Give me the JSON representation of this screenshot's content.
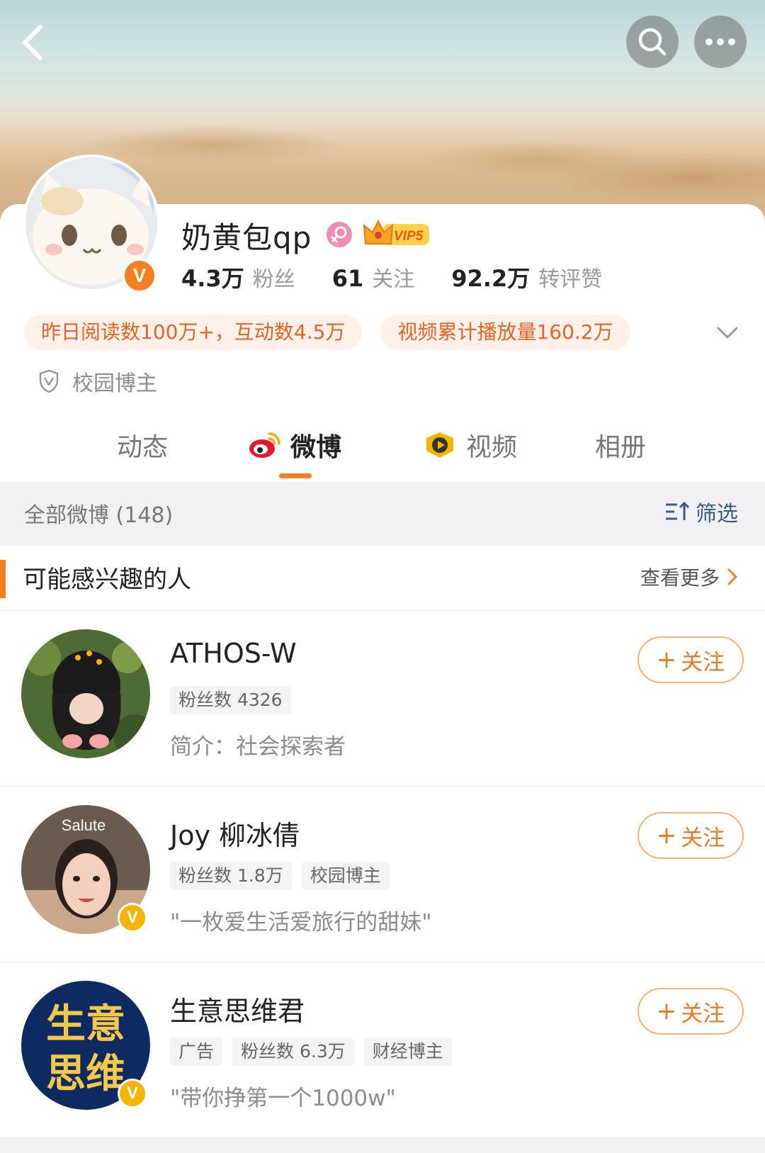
{
  "profile": {
    "name": "奶黄包qp",
    "vip_label": "VIP5",
    "stats": [
      {
        "value": "4.3万",
        "label": "粉丝"
      },
      {
        "value": "61",
        "label": "关注"
      },
      {
        "value": "92.2万",
        "label": "转评赞"
      }
    ],
    "pills": [
      "昨日阅读数100万+，互动数4.5万",
      "视频累计播放量160.2万"
    ],
    "campus_label": "校园博主",
    "verified_badge": "V"
  },
  "tabs": [
    {
      "label": "动态",
      "active": false
    },
    {
      "label": "微博",
      "active": true
    },
    {
      "label": "视频",
      "active": false
    },
    {
      "label": "相册",
      "active": false
    }
  ],
  "filter": {
    "title": "全部微博 (148)",
    "button": "筛选"
  },
  "recommend": {
    "title": "可能感兴趣的人",
    "more": "查看更多",
    "follow_label": "关注",
    "follow_plus": "+",
    "users": [
      {
        "name": "ATHOS-W",
        "tags": [
          "粉丝数 4326"
        ],
        "desc": "简介：社会探索者",
        "verified": false
      },
      {
        "name": "Joy 柳冰倩",
        "tags": [
          "粉丝数 1.8万",
          "校园博主"
        ],
        "desc": "\"一枚爱生活爱旅行的甜妹\"",
        "verified": true,
        "avatar_text": "Salute"
      },
      {
        "name": "生意思维君",
        "tags": [
          "广告",
          "粉丝数 6.3万",
          "财经博主"
        ],
        "desc": "\"带你挣第一个1000w\"",
        "verified": true,
        "avatar_text_1": "生意",
        "avatar_text_2": "思维"
      }
    ]
  },
  "colors": {
    "accent": "#f57e1f",
    "pill_bg": "#fff1e8",
    "pill_text": "#e3642a",
    "filter_blue": "#3b5a86"
  }
}
